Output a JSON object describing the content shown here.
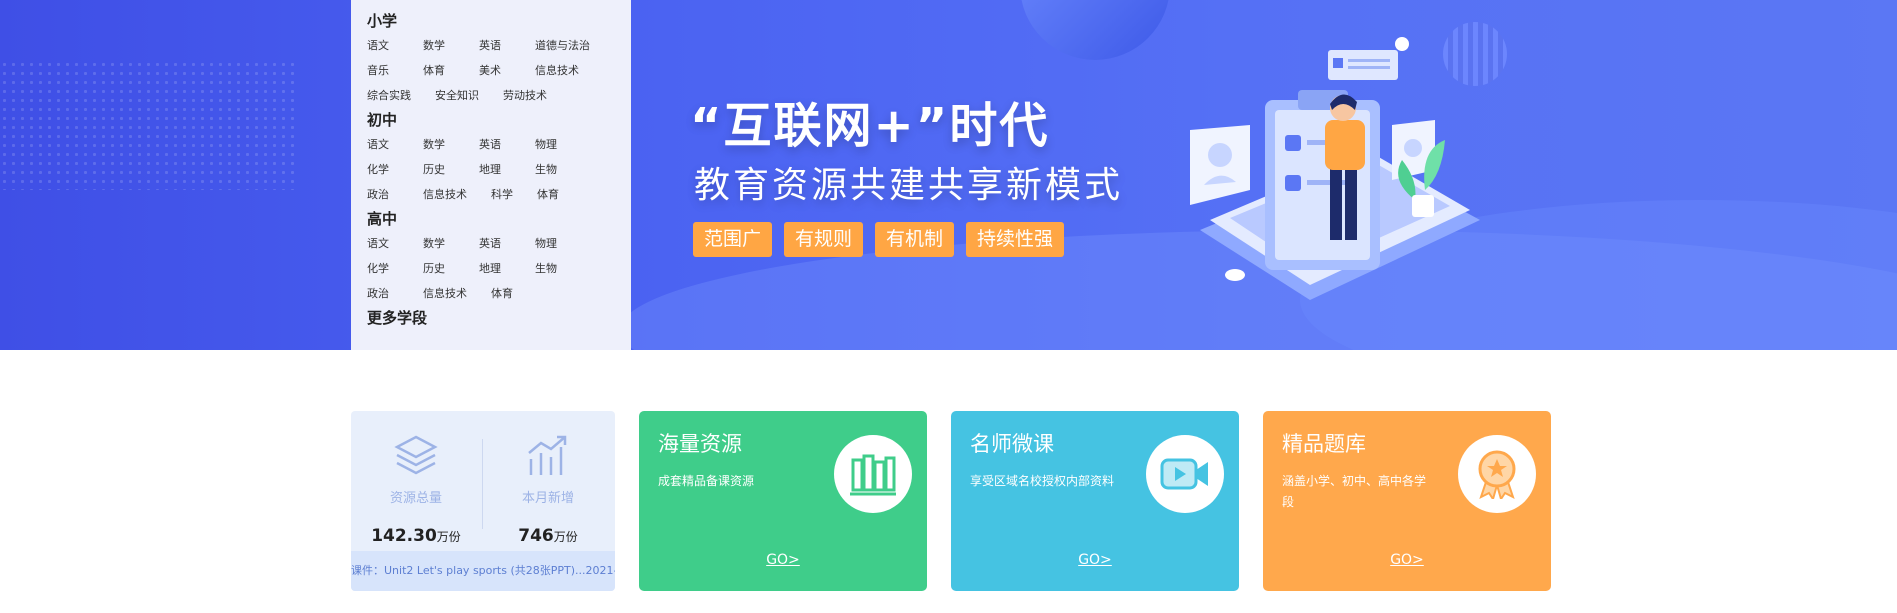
{
  "categories": {
    "groups": [
      {
        "title": "小学",
        "rows": [
          [
            "语文",
            "数学",
            "英语",
            "道德与法治"
          ],
          [
            "音乐",
            "体育",
            "美术",
            "信息技术"
          ],
          [
            "综合实践",
            "安全知识",
            "劳动技术"
          ]
        ]
      },
      {
        "title": "初中",
        "rows": [
          [
            "语文",
            "数学",
            "英语",
            "物理"
          ],
          [
            "化学",
            "历史",
            "地理",
            "生物"
          ],
          [
            "政治",
            "信息技术",
            "科学",
            "体育"
          ]
        ]
      },
      {
        "title": "高中",
        "rows": [
          [
            "语文",
            "数学",
            "英语",
            "物理"
          ],
          [
            "化学",
            "历史",
            "地理",
            "生物"
          ],
          [
            "政治",
            "信息技术",
            "体育"
          ]
        ]
      }
    ],
    "more": "更多学段"
  },
  "banner": {
    "headline": "“互联网+”时代",
    "subline": "教育资源共建共享新模式",
    "tags": [
      "范围广",
      "有规则",
      "有机制",
      "持续性强"
    ]
  },
  "stats": {
    "total_label": "资源总量",
    "total_value": "142.30",
    "total_unit": "万份",
    "month_label": "本月新增",
    "month_value": "746",
    "month_unit": "万份",
    "ticker": "课件：Unit2 Let's play sports (共28张PPT)...2021-"
  },
  "features": [
    {
      "title": "海量资源",
      "desc": "成套精品备课资源",
      "go": "GO>",
      "icon": "books-icon"
    },
    {
      "title": "名师微课",
      "desc": "享受区域名校授权内部资料",
      "go": "GO>",
      "icon": "video-camera-icon"
    },
    {
      "title": "精品题库",
      "desc": "涵盖小学、初中、高中各学段",
      "go": "GO>",
      "icon": "medal-icon"
    }
  ],
  "colors": {
    "banner": "#4b63f2",
    "tag": "#ffa644",
    "green": "#3fcd8a",
    "cyan": "#45c3e2",
    "orange": "#ffa84c"
  }
}
